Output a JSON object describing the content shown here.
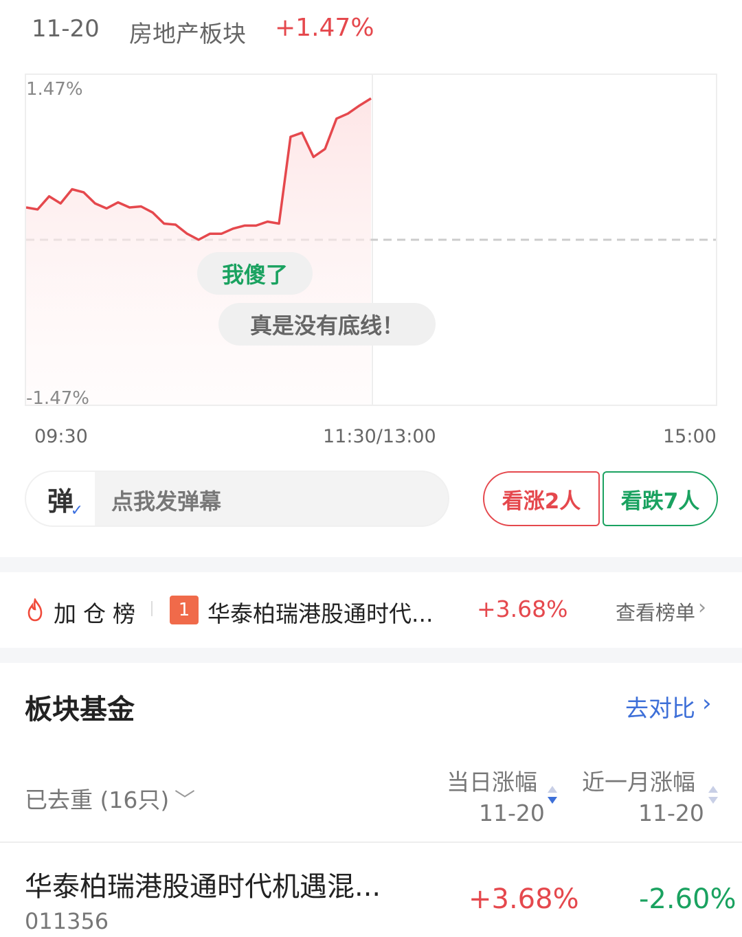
{
  "header": {
    "date": "11-20",
    "sector_name": "房地产板块",
    "sector_change": "+1.47%"
  },
  "chart": {
    "y_top_label": "1.47%",
    "y_bottom_label": "-1.47%",
    "x_labels": [
      "09:30",
      "11:30/13:00",
      "15:00"
    ]
  },
  "chart_data": {
    "type": "line",
    "title": "",
    "xlabel": "",
    "ylabel": "",
    "ylim": [
      -1.47,
      1.47
    ],
    "x_ticks": [
      "09:30",
      "11:30/13:00",
      "15:00"
    ],
    "x": [
      0,
      4,
      8,
      12,
      16,
      20,
      24,
      28,
      32,
      36,
      40,
      44,
      48,
      52,
      56,
      60,
      64,
      68,
      72,
      76,
      80,
      84,
      88,
      92,
      96,
      100,
      104,
      108,
      112,
      116,
      120
    ],
    "series": [
      {
        "values": [
          0.32,
          0.3,
          0.43,
          0.36,
          0.5,
          0.47,
          0.36,
          0.31,
          0.37,
          0.32,
          0.33,
          0.27,
          0.16,
          0.15,
          0.06,
          0.0,
          0.06,
          0.06,
          0.11,
          0.14,
          0.14,
          0.18,
          0.16,
          1.02,
          1.06,
          0.82,
          0.9,
          1.2,
          1.25,
          1.33,
          1.4
        ],
        "color": "#e5484d"
      }
    ],
    "reference_line": 0,
    "reference_style": "dashed"
  },
  "danmaku": {
    "bubbles": [
      "我傻了",
      "真是没有底线！"
    ],
    "badge": "弹",
    "input_placeholder": "点我发弹幕"
  },
  "votes": {
    "up_label": "看涨2人",
    "down_label": "看跌7人"
  },
  "ranking": {
    "title": "加仓榜",
    "rank_number": "1",
    "fund_name": "华泰柏瑞港股通时代...",
    "change": "+3.68%",
    "link_text": "查看榜单"
  },
  "sector_funds": {
    "title": "板块基金",
    "compare_text": "去对比",
    "dedup_text": "已去重 (16只)",
    "col_day_title": "当日涨幅",
    "col_day_date": "11-20",
    "col_month_title": "近一月涨幅",
    "col_month_date": "11-20",
    "rows": [
      {
        "name": "华泰柏瑞港股通时代机遇混...",
        "code": "011356",
        "day_change": "+3.68%",
        "month_change": "-2.60%"
      }
    ]
  },
  "colors": {
    "up": "#e5484d",
    "down": "#1aa260",
    "link": "#3d6fd8"
  }
}
